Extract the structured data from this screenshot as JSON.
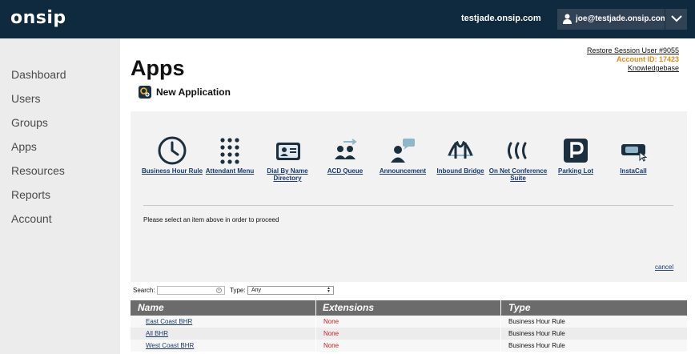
{
  "header": {
    "logo": "onsip",
    "domain": "testjade.onsip.com",
    "user": "joe@testjade.onsip.com"
  },
  "sidebar": {
    "items": [
      {
        "label": "Dashboard"
      },
      {
        "label": "Users"
      },
      {
        "label": "Groups"
      },
      {
        "label": "Apps"
      },
      {
        "label": "Resources"
      },
      {
        "label": "Reports"
      },
      {
        "label": "Account"
      }
    ]
  },
  "page": {
    "title": "Apps",
    "restore_session": "Restore Session User #9055",
    "account_id": "Account ID: 17423",
    "knowledgebase": "Knowledgebase",
    "new_application": "New Application"
  },
  "apps": [
    {
      "label": "Business Hour Rule",
      "icon": "clock-icon"
    },
    {
      "label": "Attendant Menu",
      "icon": "keypad-icon"
    },
    {
      "label": "Dial By Name Directory",
      "icon": "directory-icon"
    },
    {
      "label": "ACD Queue",
      "icon": "queue-icon"
    },
    {
      "label": "Announcement",
      "icon": "announcement-icon"
    },
    {
      "label": "Inbound Bridge",
      "icon": "bridge-icon"
    },
    {
      "label": "On Net Conference Suite",
      "icon": "conference-icon"
    },
    {
      "label": "Parking Lot",
      "icon": "parking-icon"
    },
    {
      "label": "InstaCall",
      "icon": "instacall-icon"
    }
  ],
  "panel": {
    "message": "Please select an item above in order to proceed",
    "cancel": "cancel"
  },
  "filters": {
    "search_label": "Search:",
    "search_value": "",
    "type_label": "Type:",
    "type_value": "Any"
  },
  "table": {
    "columns": [
      "Name",
      "Extensions",
      "Type"
    ],
    "rows": [
      {
        "name": "East Coast BHR",
        "extensions": "None",
        "type": "Business Hour Rule"
      },
      {
        "name": "All BHR",
        "extensions": "None",
        "type": "Business Hour Rule"
      },
      {
        "name": "West Coast BHR",
        "extensions": "None",
        "type": "Business Hour Rule"
      }
    ]
  },
  "colors": {
    "topbar": "#0f2a3e",
    "accent_orange": "#e58a12",
    "link_blue": "#1b3a6b",
    "none_red": "#cc1f1f",
    "icon_dark": "#1b2f3f"
  }
}
